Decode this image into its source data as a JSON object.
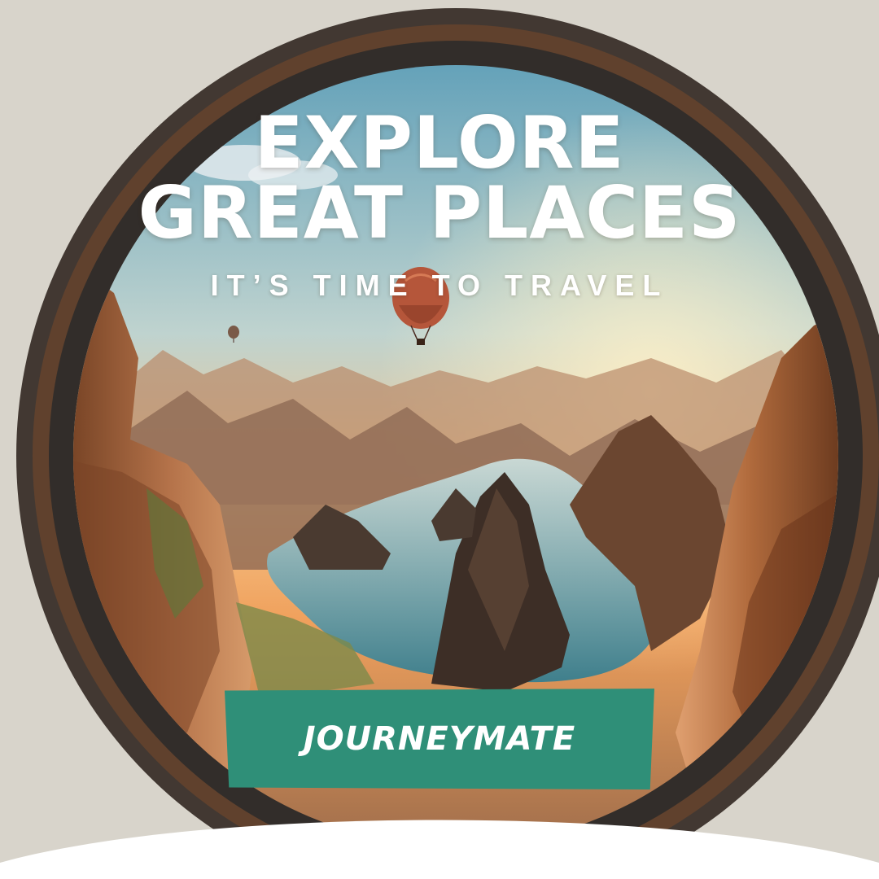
{
  "headline": {
    "line1": "EXPLORE",
    "line2": "GREAT PLACES"
  },
  "tagline": "IT’S TIME TO TRAVEL",
  "brand": "JOURNEYMATE",
  "colors": {
    "banner": "#2f8f78",
    "sky_top": "#5f9fb8",
    "sky_horizon": "#f5b46a",
    "frame_brush": "#2a2522",
    "background": "#d8d4cb"
  },
  "icons": [
    "hot-air-balloon",
    "mountains",
    "river"
  ]
}
